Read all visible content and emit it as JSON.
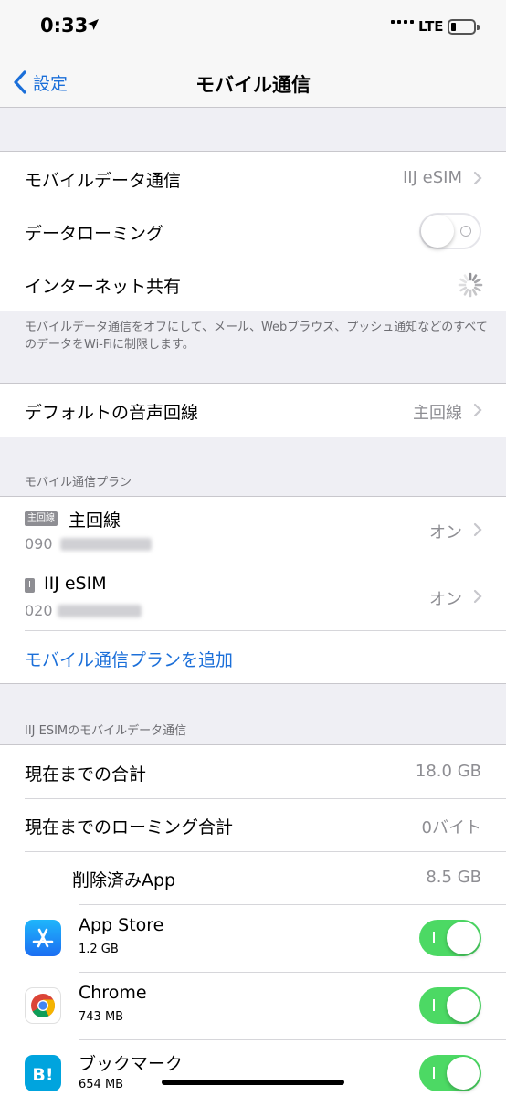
{
  "status_bar": {
    "time": "0:33",
    "network": "LTE"
  },
  "nav": {
    "back_label": "設定",
    "title": "モバイル通信"
  },
  "group1": {
    "mobile_data": {
      "label": "モバイルデータ通信",
      "value": "IIJ eSIM"
    },
    "roaming": {
      "label": "データローミング",
      "on": false
    },
    "hotspot": {
      "label": "インターネット共有"
    }
  },
  "footnote1": "モバイルデータ通信をオフにして、メール、Webブラウズ、プッシュ通知などのすべてのデータをWi-Fiに制限します。",
  "voice": {
    "label": "デフォルトの音声回線",
    "value": "主回線"
  },
  "plans": {
    "header": "モバイル通信プラン",
    "items": [
      {
        "badge": "主回線",
        "name": "主回線",
        "number_prefix": "090",
        "status": "オン"
      },
      {
        "badge": "I",
        "name": "IIJ eSIM",
        "number_prefix": "020",
        "status": "オン"
      }
    ],
    "add_label": "モバイル通信プランを追加"
  },
  "usage": {
    "header": "IIJ ESIMのモバイルデータ通信",
    "total": {
      "label": "現在までの合計",
      "value": "18.0 GB"
    },
    "roaming_total": {
      "label": "現在までのローミング合計",
      "value": "0バイト"
    },
    "deleted_apps": {
      "label": "削除済みApp",
      "value": "8.5 GB"
    }
  },
  "apps": [
    {
      "name": "App Store",
      "size": "1.2 GB",
      "icon": "app-store-icon",
      "on": true
    },
    {
      "name": "Chrome",
      "size": "743 MB",
      "icon": "chrome-icon",
      "on": true
    },
    {
      "name": "ブックマーク",
      "size": "654 MB",
      "icon": "hatena-bookmark-icon",
      "on": true
    }
  ],
  "colors": {
    "accent": "#1b6fd9",
    "toggle_on": "#4cd964",
    "background": "#efeff4"
  }
}
